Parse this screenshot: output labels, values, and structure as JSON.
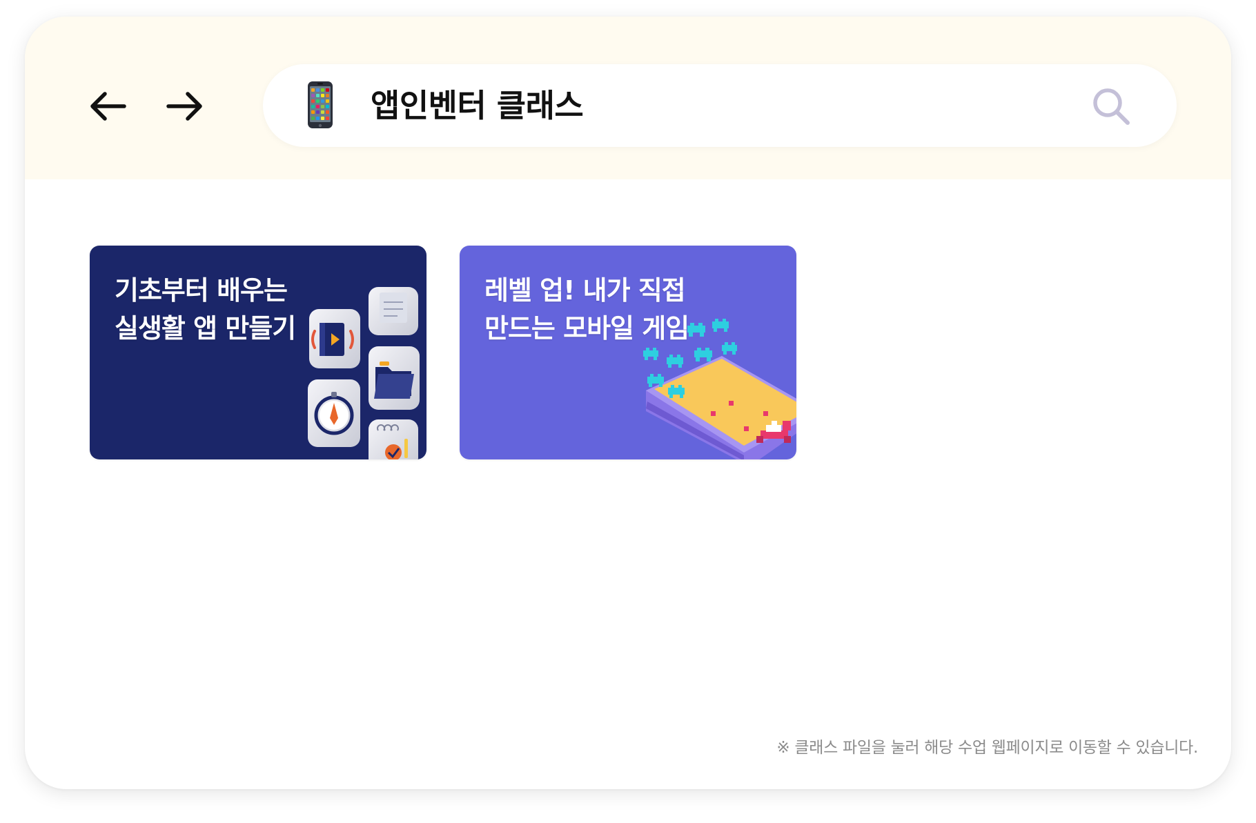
{
  "address_bar": {
    "title": "앱인벤터 클래스",
    "icon": "mobile-phone-icon"
  },
  "navigation": {
    "back_icon": "arrow-left-icon",
    "forward_icon": "arrow-right-icon",
    "search_icon": "search-icon"
  },
  "cards": [
    {
      "title_line1": "기초부터 배우는",
      "title_line2": "실생활 앱 만들기",
      "background": "#1b2669",
      "illustration": "app-icons-illustration"
    },
    {
      "title_line1": "레벨 업! 내가 직접",
      "title_line2": "만드는 모바일 게임",
      "background": "#6464dc",
      "illustration": "phone-game-illustration"
    }
  ],
  "footnote": "※ 클래스 파일을 눌러 해당 수업 웹페이지로 이동할 수 있습니다.",
  "colors": {
    "topbar": "#fffbf0",
    "search_icon": "#c4c0d8",
    "footnote_text": "#8b8b8b"
  }
}
